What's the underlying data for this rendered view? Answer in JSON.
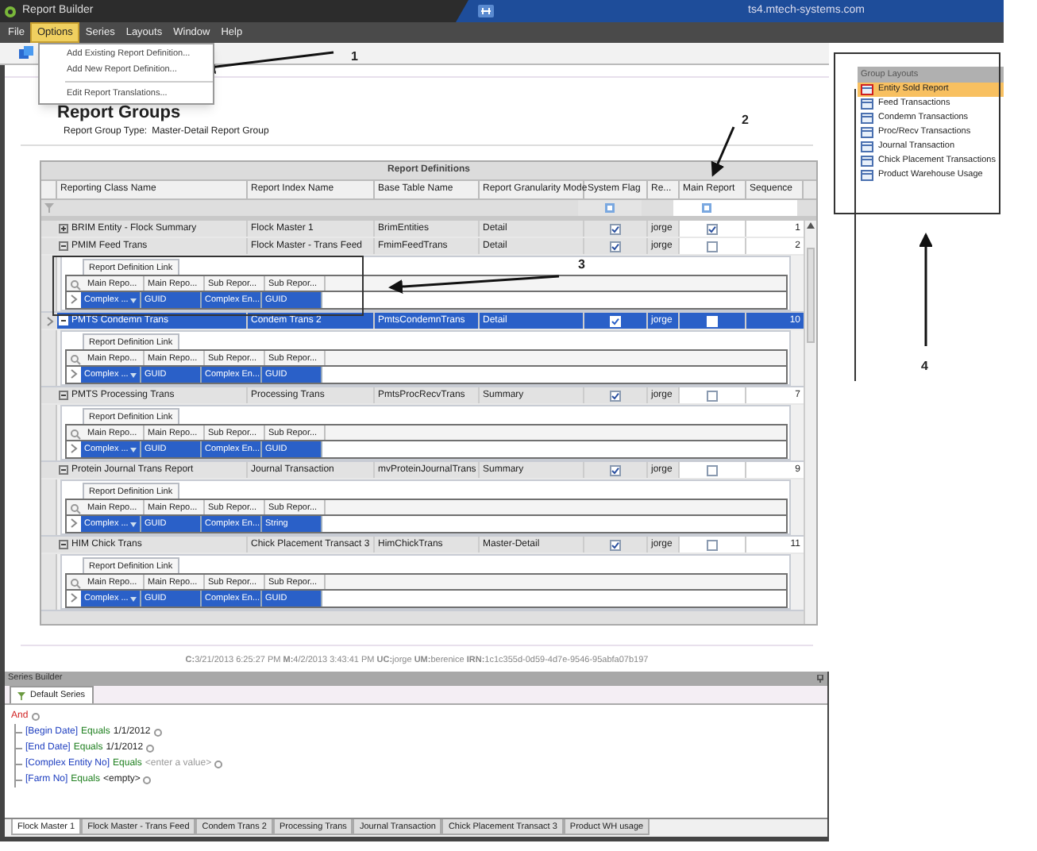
{
  "window": {
    "title": "Report Builder",
    "host": "ts4.mtech-systems.com"
  },
  "menu": [
    {
      "label": "File",
      "selected": false
    },
    {
      "label": "Options",
      "selected": true
    },
    {
      "label": "Series",
      "selected": false
    },
    {
      "label": "Layouts",
      "selected": false
    },
    {
      "label": "Window",
      "selected": false
    },
    {
      "label": "Help",
      "selected": false
    }
  ],
  "options_menu": [
    {
      "label": "Add Existing Report Definition..."
    },
    {
      "label": "Add New Report Definition..."
    },
    {
      "label": "Edit Report Translations..."
    }
  ],
  "page": {
    "heading": "Report Groups",
    "group_type_label": "Report Group Type:",
    "group_type": "Master-Detail Report Group"
  },
  "grid": {
    "title": "Report Definitions",
    "columns": [
      "Reporting Class Name",
      "Report Index Name",
      "Base Table Name",
      "Report Granularity Mode",
      "System Flag",
      "Re...",
      "Main Report",
      "Sequence"
    ],
    "rows": [
      {
        "cells": [
          "BRIM Entity - Flock Summary",
          "Flock Master 1",
          "BrimEntities",
          "Detail"
        ],
        "system_flag": true,
        "owner": "jorge",
        "main_report": true,
        "sequence": "1",
        "expanded": false,
        "selected": false
      },
      {
        "cells": [
          "PMIM Feed Trans",
          "Flock Master - Trans Feed",
          "FmimFeedTrans",
          "Detail"
        ],
        "system_flag": true,
        "owner": "jorge",
        "main_report": false,
        "sequence": "2",
        "expanded": true,
        "selected": false,
        "link": {
          "tab": "Report Definition Link",
          "columns": [
            "Main Repo...",
            "Main Repo...",
            "Sub Repor...",
            "Sub Repor..."
          ],
          "values": [
            "Complex ...",
            "GUID",
            "Complex En...",
            "GUID"
          ]
        }
      },
      {
        "cells": [
          "PMTS Condemn Trans",
          "Condem Trans 2",
          "PmtsCondemnTrans",
          "Detail"
        ],
        "system_flag": true,
        "owner": "jorge",
        "main_report": false,
        "sequence": "10",
        "expanded": true,
        "selected": true,
        "link": {
          "tab": "Report Definition Link",
          "columns": [
            "Main Repo...",
            "Main Repo...",
            "Sub Repor...",
            "Sub Repor..."
          ],
          "values": [
            "Complex ...",
            "GUID",
            "Complex En...",
            "GUID"
          ]
        }
      },
      {
        "cells": [
          "PMTS Processing Trans",
          "Processing Trans",
          "PmtsProcRecvTrans",
          "Summary"
        ],
        "system_flag": true,
        "owner": "jorge",
        "main_report": false,
        "sequence": "7",
        "expanded": true,
        "selected": false,
        "link": {
          "tab": "Report Definition Link",
          "columns": [
            "Main Repo...",
            "Main Repo...",
            "Sub Repor...",
            "Sub Repor..."
          ],
          "values": [
            "Complex ...",
            "GUID",
            "Complex En...",
            "GUID"
          ]
        }
      },
      {
        "cells": [
          "Protein Journal Trans Report",
          "Journal Transaction",
          "mvProteinJournalTrans",
          "Summary"
        ],
        "system_flag": true,
        "owner": "jorge",
        "main_report": false,
        "sequence": "9",
        "expanded": true,
        "selected": false,
        "link": {
          "tab": "Report Definition Link",
          "columns": [
            "Main Repo...",
            "Main Repo...",
            "Sub Repor...",
            "Sub Repor..."
          ],
          "values": [
            "Complex ...",
            "GUID",
            "Complex En...",
            "String"
          ]
        }
      },
      {
        "cells": [
          "HIM Chick Trans",
          "Chick Placement Transact 3",
          "HimChickTrans",
          "Master-Detail"
        ],
        "system_flag": true,
        "owner": "jorge",
        "main_report": false,
        "sequence": "11",
        "expanded": true,
        "selected": false,
        "link": {
          "tab": "Report Definition Link",
          "columns": [
            "Main Repo...",
            "Main Repo...",
            "Sub Repor...",
            "Sub Repor..."
          ],
          "values": [
            "Complex ...",
            "GUID",
            "Complex En...",
            "GUID"
          ]
        }
      }
    ]
  },
  "audit_line": "**C:**3/21/2013 6:25:27 PM **M:**4/2/2013 3:43:41 PM **UC:**jorge **UM:**berenice **IRN:**1c1c355d-0d59-4d7e-9546-95abfa07b197",
  "series_builder": {
    "title": "Series Builder",
    "tab": "Default Series",
    "root": "And",
    "conditions": [
      {
        "field": "[Begin Date]",
        "op": "Equals",
        "value": "1/1/2012",
        "kind": "value"
      },
      {
        "field": "[End Date]",
        "op": "Equals",
        "value": "1/1/2012",
        "kind": "value"
      },
      {
        "field": "[Complex Entity No]",
        "op": "Equals",
        "value": "<enter a value>",
        "kind": "placeholder"
      },
      {
        "field": "[Farm No]",
        "op": "Equals",
        "value": "<empty>",
        "kind": "value"
      }
    ]
  },
  "bottom_tabs": [
    {
      "label": "Flock Master 1",
      "selected": true
    },
    {
      "label": "Flock Master - Trans Feed",
      "selected": false
    },
    {
      "label": "Condem Trans 2",
      "selected": false
    },
    {
      "label": "Processing Trans",
      "selected": false
    },
    {
      "label": "Journal Transaction",
      "selected": false
    },
    {
      "label": "Chick Placement Transact 3",
      "selected": false
    },
    {
      "label": "Product WH usage",
      "selected": false
    }
  ],
  "group_layouts": {
    "title": "Group Layouts",
    "items": [
      {
        "label": "Entity Sold Report",
        "selected": true
      },
      {
        "label": "Feed Transactions",
        "selected": false
      },
      {
        "label": "Condemn Transactions",
        "selected": false
      },
      {
        "label": "Proc/Recv Transactions",
        "selected": false
      },
      {
        "label": "Journal Transaction",
        "selected": false
      },
      {
        "label": "Chick Placement Transactions",
        "selected": false
      },
      {
        "label": "Product Warehouse Usage",
        "selected": false
      }
    ]
  },
  "annotations": [
    {
      "label": "1"
    },
    {
      "label": "2"
    },
    {
      "label": "3"
    },
    {
      "label": "4"
    }
  ]
}
